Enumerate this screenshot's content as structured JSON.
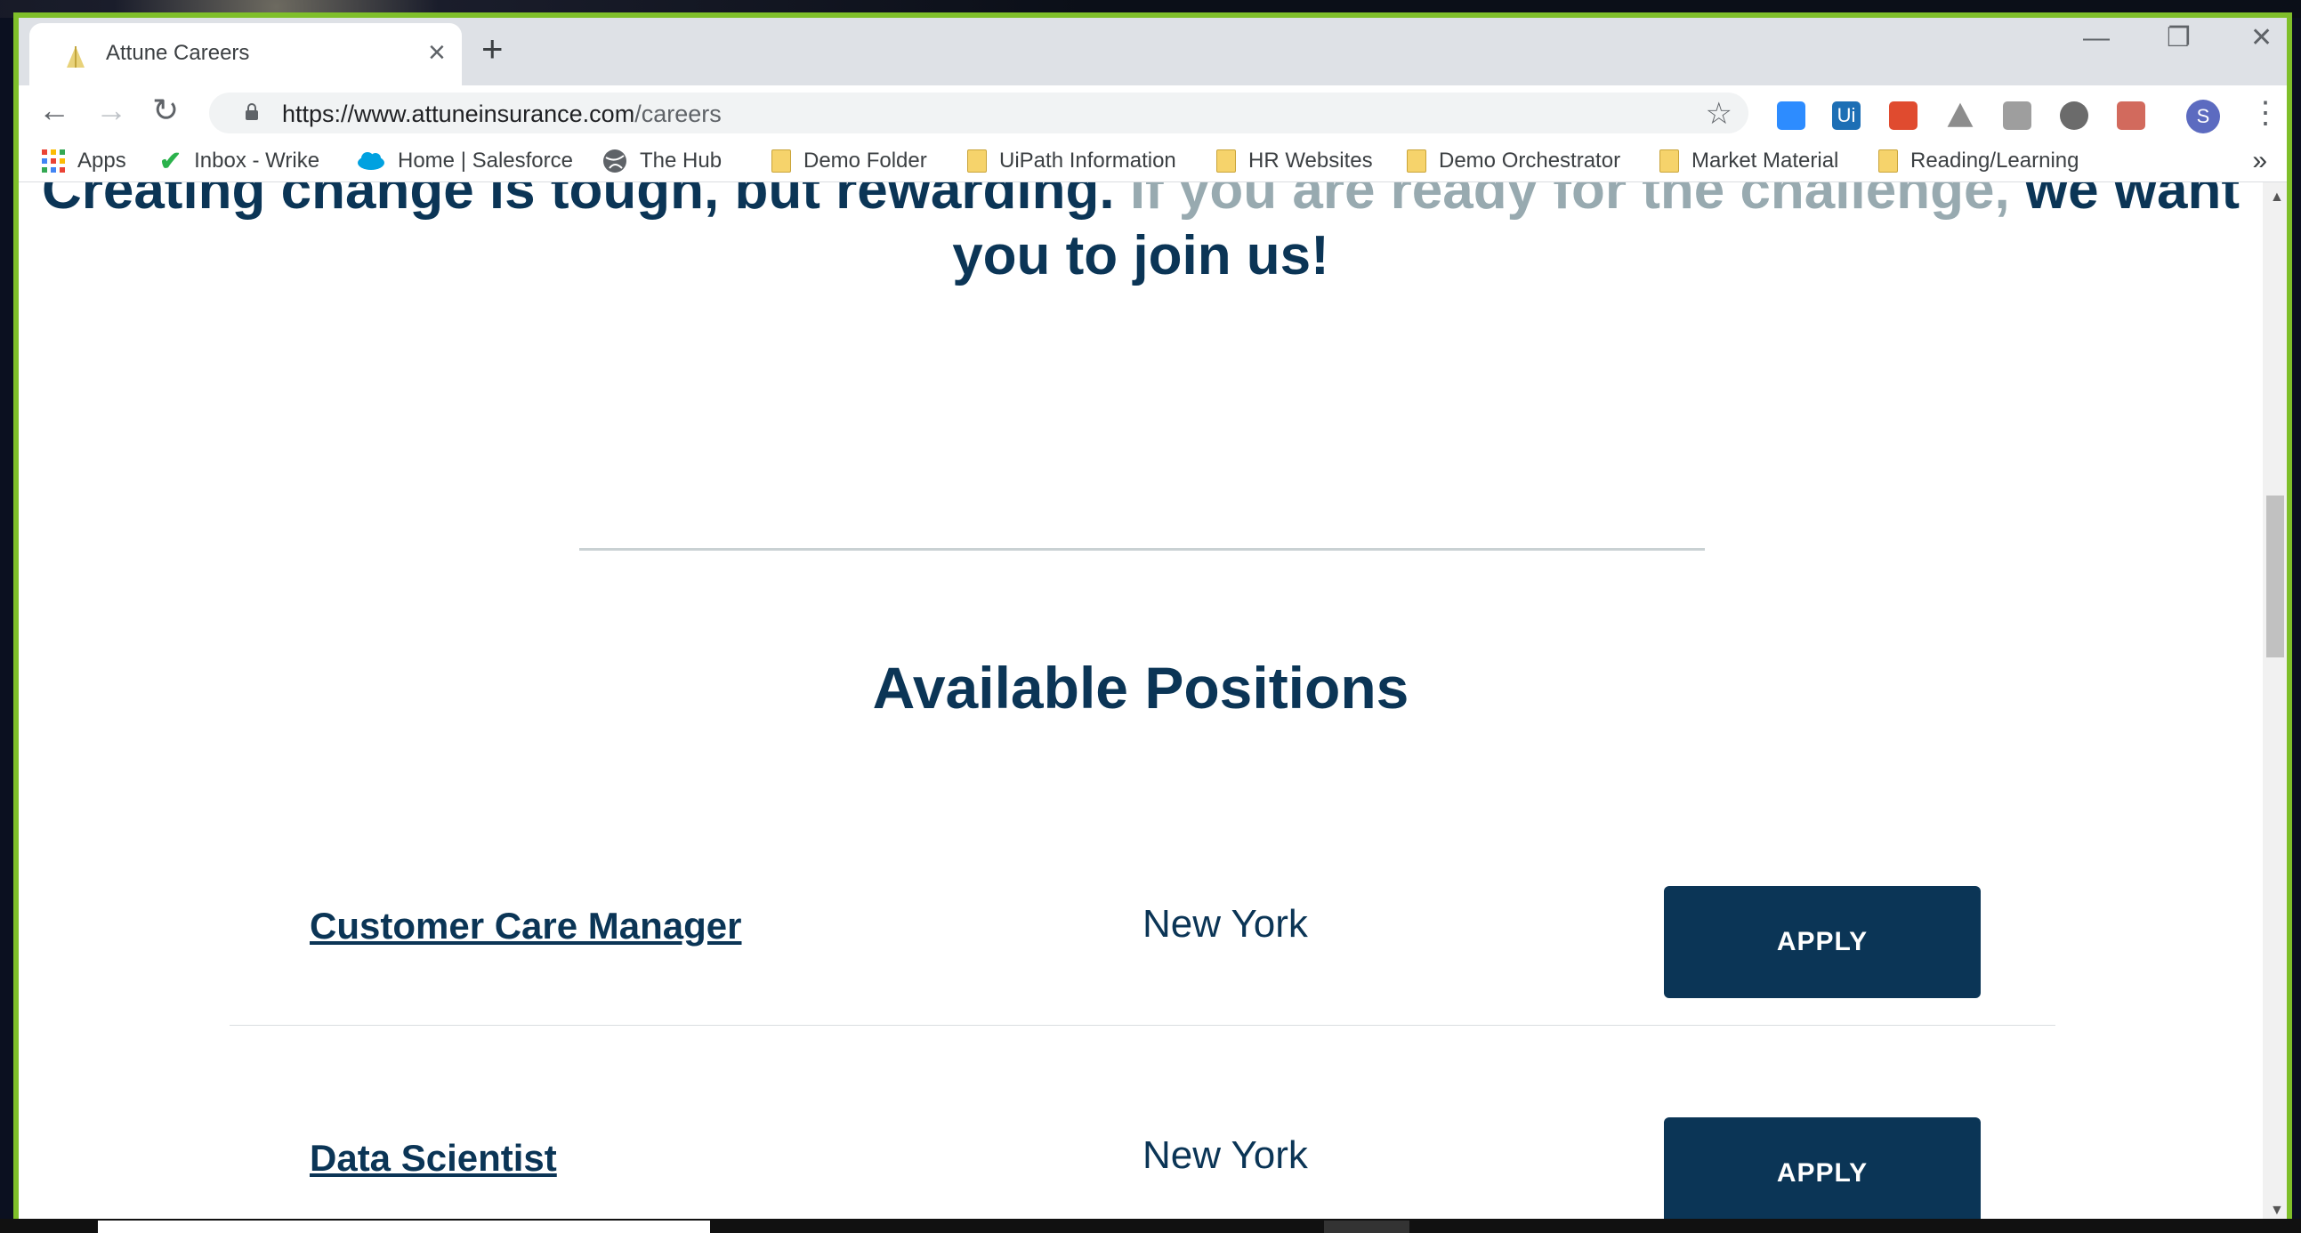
{
  "browser": {
    "tab_title": "Attune Careers",
    "url_host": "https://www.attuneinsurance.com",
    "url_path": "/careers",
    "avatar_letter": "S",
    "extensions": [
      "zoom-icon",
      "uipath-icon",
      "clipper-icon",
      "drive-icon",
      "bookmark-ext-icon",
      "circle-ext-icon",
      "pdf-icon"
    ]
  },
  "bookmarks": [
    {
      "label": "Apps",
      "icon": "apps-grid-icon"
    },
    {
      "label": "Inbox - Wrike",
      "icon": "check-icon"
    },
    {
      "label": "Home | Salesforce",
      "icon": "cloud-icon"
    },
    {
      "label": "The Hub",
      "icon": "globe-icon"
    },
    {
      "label": "Demo Folder",
      "icon": "folder-icon"
    },
    {
      "label": "UiPath Information",
      "icon": "folder-icon"
    },
    {
      "label": "HR Websites",
      "icon": "folder-icon"
    },
    {
      "label": "Demo Orchestrator",
      "icon": "folder-icon"
    },
    {
      "label": "Market Material",
      "icon": "folder-icon"
    },
    {
      "label": "Reading/Learning",
      "icon": "folder-icon"
    }
  ],
  "page": {
    "headline_part1": "Creating change is tough, but rewarding. ",
    "headline_part2": "If you are ready for the challenge, ",
    "headline_part3": "we want you to join us!",
    "positions_title": "Available Positions",
    "jobs": [
      {
        "title": "Customer Care Manager",
        "location": "New York",
        "apply_label": "APPLY"
      },
      {
        "title": "Data Scientist",
        "location": "New York",
        "apply_label": "APPLY"
      }
    ]
  },
  "colors": {
    "navy": "#0b3556",
    "muted": "#98aab0",
    "window_border": "#7fbf2a"
  }
}
